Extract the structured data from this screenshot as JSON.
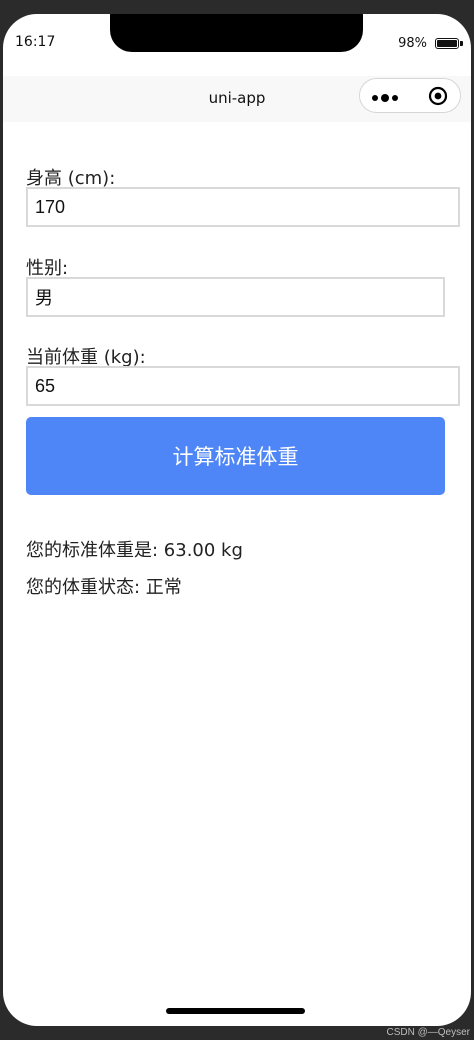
{
  "status_bar": {
    "time": "16:17",
    "battery": "98%"
  },
  "navbar": {
    "title": "uni-app"
  },
  "form": {
    "height_label": "身高 (cm):",
    "height_value": "170",
    "gender_label": "性别:",
    "gender_value": "男",
    "weight_label": "当前体重 (kg):",
    "weight_value": "65"
  },
  "button": {
    "label": "计算标准体重"
  },
  "results": {
    "standard_weight": "您的标准体重是: 63.00 kg",
    "weight_status": "您的体重状态: 正常"
  },
  "watermark": "CSDN @—Qeyser",
  "icons": {
    "more": "more-dots-icon",
    "close": "mini-program-close-icon",
    "battery": "battery-icon"
  },
  "colors": {
    "button_bg": "#4f86f7",
    "button_text": "#ffffff",
    "navbar_bg": "#f8f8f8"
  }
}
